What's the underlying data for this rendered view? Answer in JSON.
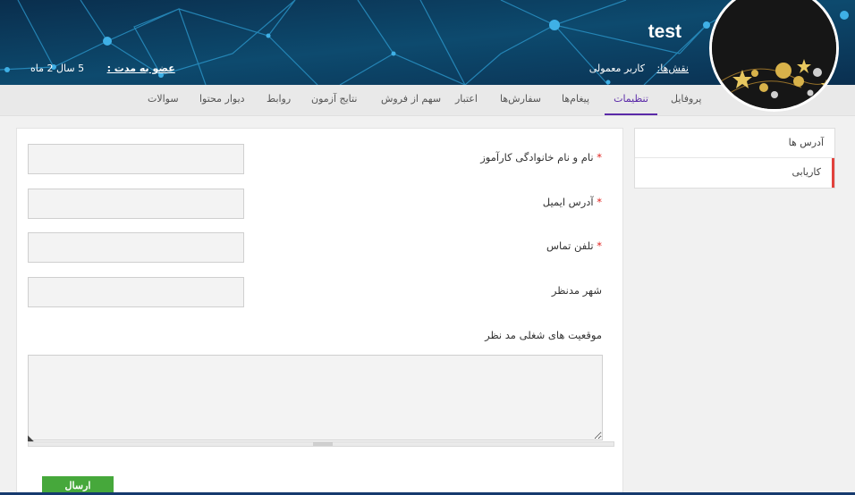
{
  "header": {
    "username": "test",
    "roles_label": "نقش‌ها:",
    "role_value": "کاربر معمولی",
    "membership_label": "عضو به مدت :",
    "membership_value": "5 سال 2 ماه"
  },
  "tabs": [
    {
      "label": "پروفایل",
      "active": false
    },
    {
      "label": "تنظیمات",
      "active": true
    },
    {
      "label": "پیغام‌ها",
      "active": false
    },
    {
      "label": "سفارش‌ها",
      "active": false
    },
    {
      "label": "اعتبار",
      "active": false
    },
    {
      "label": "سهم از فروش",
      "active": false
    },
    {
      "label": "نتایج آزمون",
      "active": false
    },
    {
      "label": "روابط",
      "active": false
    },
    {
      "label": "دیوار محتوا",
      "active": false
    },
    {
      "label": "سوالات",
      "active": false
    }
  ],
  "sidebar": {
    "items": [
      {
        "label": "آدرس ها"
      },
      {
        "label": "کاریابی"
      }
    ]
  },
  "form": {
    "fields": [
      {
        "label": "نام و نام خانوادگی کارآموز",
        "required": true,
        "value": ""
      },
      {
        "label": "آدرس ایمیل",
        "required": true,
        "value": ""
      },
      {
        "label": "تلفن تماس",
        "required": true,
        "value": ""
      },
      {
        "label": "شهر مدنظر",
        "required": false,
        "value": ""
      }
    ],
    "textarea_label": "موقعیت های شغلی مد نظر",
    "textarea_value": "",
    "required_mark": "*",
    "submit_label": "ارسال"
  },
  "colors": {
    "banner": "#0b3a5c",
    "active_tab": "#5b2aa8",
    "submit": "#46a83b",
    "required": "#e1231f",
    "sidebar_active_marker": "#e2423d"
  }
}
